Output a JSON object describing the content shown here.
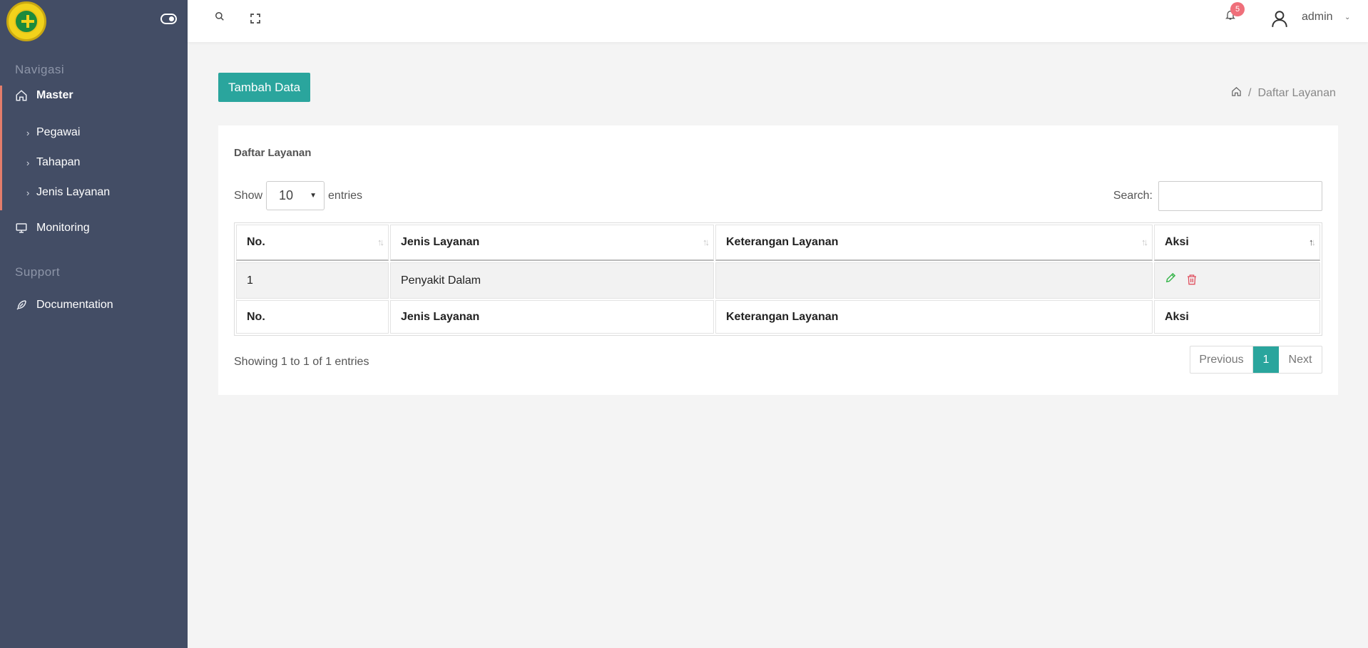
{
  "sidebar": {
    "sections": {
      "navigasi": "Navigasi",
      "support": "Support"
    },
    "master": {
      "label": "Master",
      "icon": "home-icon"
    },
    "subitems": [
      {
        "label": "Pegawai"
      },
      {
        "label": "Tahapan"
      },
      {
        "label": "Jenis Layanan"
      }
    ],
    "monitoring": {
      "label": "Monitoring",
      "icon": "monitor-icon"
    },
    "documentation": {
      "label": "Documentation",
      "icon": "feather-icon"
    }
  },
  "topbar": {
    "notification_count": "5",
    "username": "admin"
  },
  "main": {
    "add_button": "Tambah Data",
    "breadcrumb": {
      "separator": "/",
      "current": "Daftar Layanan"
    },
    "card_title": "Daftar Layanan",
    "show_label": "Show",
    "entries_value": "10",
    "entries_label": "entries",
    "search_label": "Search:",
    "table": {
      "headers": [
        "No.",
        "Jenis Layanan",
        "Keterangan Layanan",
        "Aksi"
      ],
      "rows": [
        {
          "no": "1",
          "jenis": "Penyakit Dalam",
          "keterangan": ""
        }
      ]
    },
    "info": "Showing 1 to 1 of 1 entries",
    "pagination": {
      "previous": "Previous",
      "current": "1",
      "next": "Next"
    }
  },
  "colors": {
    "accent": "#2aa59d",
    "sidebar": "#434d65",
    "badge": "#ef6f7a",
    "edit": "#36b54a",
    "delete": "#e0505f"
  }
}
